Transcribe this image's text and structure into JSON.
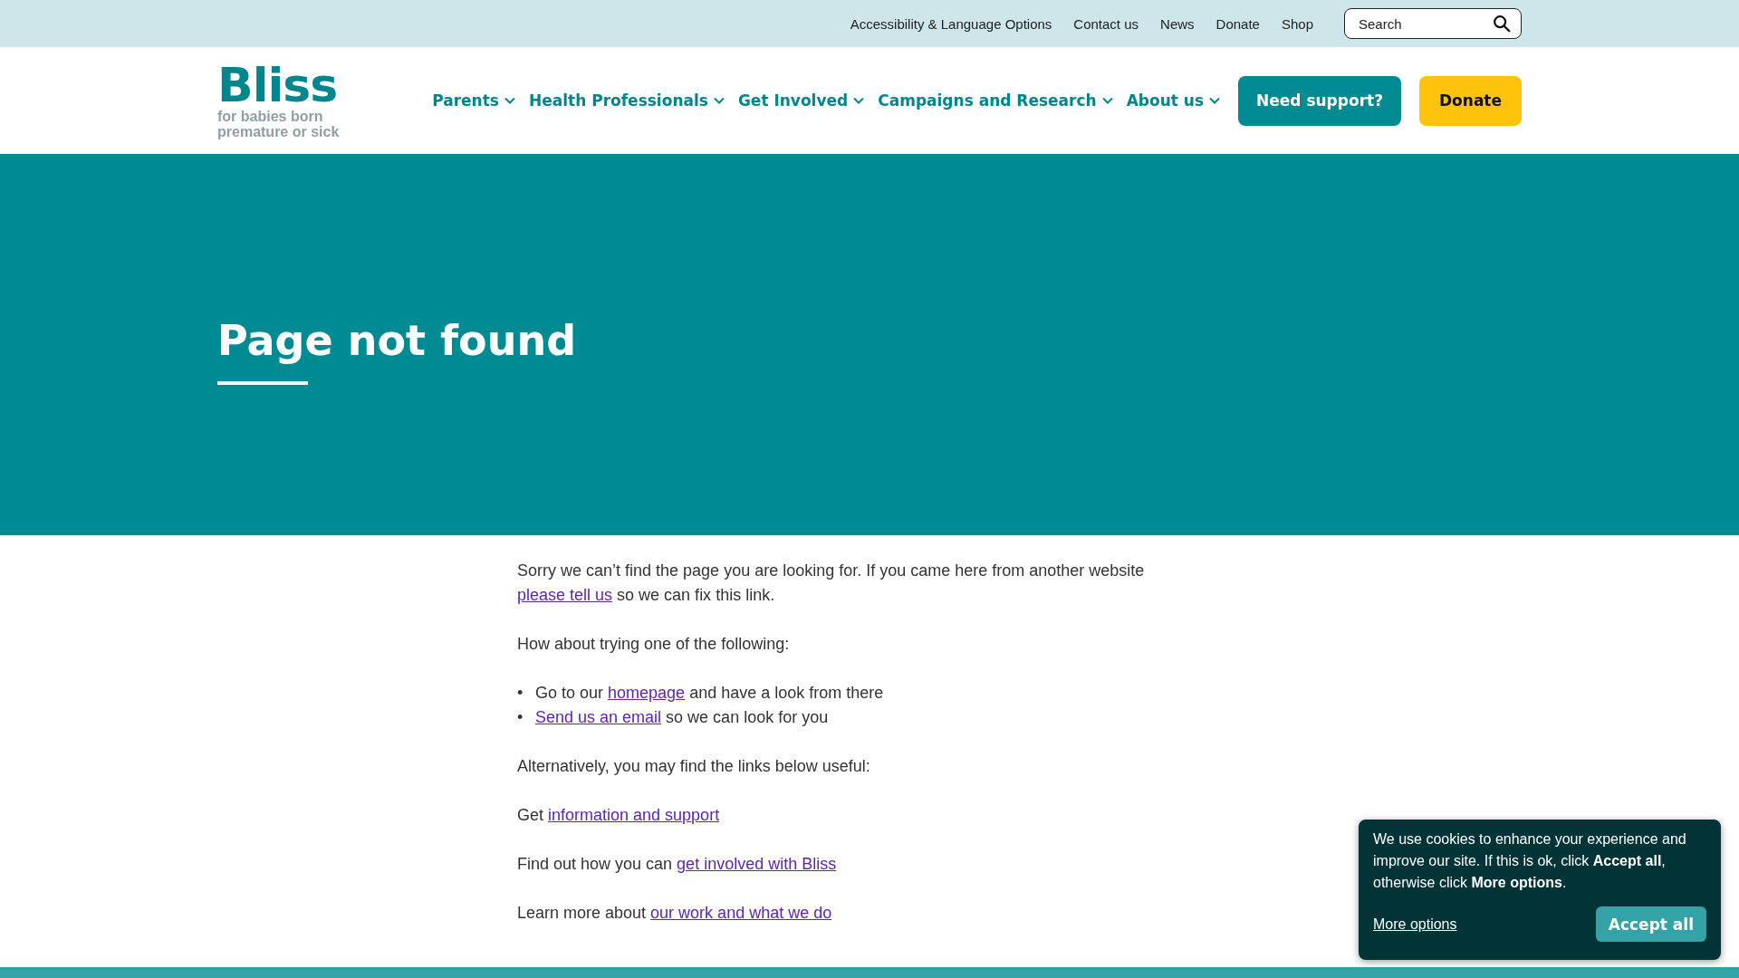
{
  "top_links": [
    "Accessibility & Language Options",
    "Contact us",
    "News",
    "Donate",
    "Shop"
  ],
  "search": {
    "placeholder": "Search"
  },
  "logo": {
    "name": "Bliss",
    "tagline": "for babies born premature or sick"
  },
  "nav": [
    "Parents",
    "Health Professionals",
    "Get Involved",
    "Campaigns and Research",
    "About us"
  ],
  "header_buttons": [
    {
      "label": "Need support?",
      "kind": "primary"
    },
    {
      "label": "Donate",
      "kind": "donate"
    }
  ],
  "hero": {
    "title": "Page not found"
  },
  "content": [
    {
      "kind": "paragraph",
      "parts": [
        {
          "text": "Sorry we can’t find the page you are looking for. If you came here from another website ",
          "kind": "text"
        },
        {
          "text": "please tell us",
          "kind": "link"
        },
        {
          "text": " so we can fix this link.",
          "kind": "text"
        }
      ]
    },
    {
      "kind": "paragraph",
      "parts": [
        {
          "text": "How about trying one of the following:",
          "kind": "text"
        }
      ]
    },
    {
      "kind": "bullets",
      "items": [
        {
          "marker": "•",
          "parts": [
            {
              "text": "Go to our ",
              "kind": "text"
            },
            {
              "text": "homepage",
              "kind": "link"
            },
            {
              "text": " and have a look from there",
              "kind": "text"
            }
          ]
        },
        {
          "marker": "•",
          "parts": [
            {
              "text": "Send us an email",
              "kind": "link"
            },
            {
              "text": " so we can look for you",
              "kind": "text"
            }
          ]
        }
      ]
    },
    {
      "kind": "paragraph",
      "parts": [
        {
          "text": "Alternatively, you may find the links below useful:",
          "kind": "text"
        }
      ]
    },
    {
      "kind": "paragraph",
      "parts": [
        {
          "text": "Get ",
          "kind": "text"
        },
        {
          "text": "information and support",
          "kind": "link"
        }
      ]
    },
    {
      "kind": "paragraph",
      "parts": [
        {
          "text": "Find out how you can ",
          "kind": "text"
        },
        {
          "text": "get involved with Bliss",
          "kind": "link"
        }
      ]
    },
    {
      "kind": "paragraph",
      "parts": [
        {
          "text": "Learn more about ",
          "kind": "text"
        },
        {
          "text": "our work and what we do",
          "kind": "link"
        }
      ]
    }
  ],
  "cookie_banner": {
    "text": "We use cookies to enhance your experience and improve our site. If this is ok, click **Accept all**, otherwise click **More options**.",
    "more_link": "More options",
    "accept_button": "Accept all"
  }
}
